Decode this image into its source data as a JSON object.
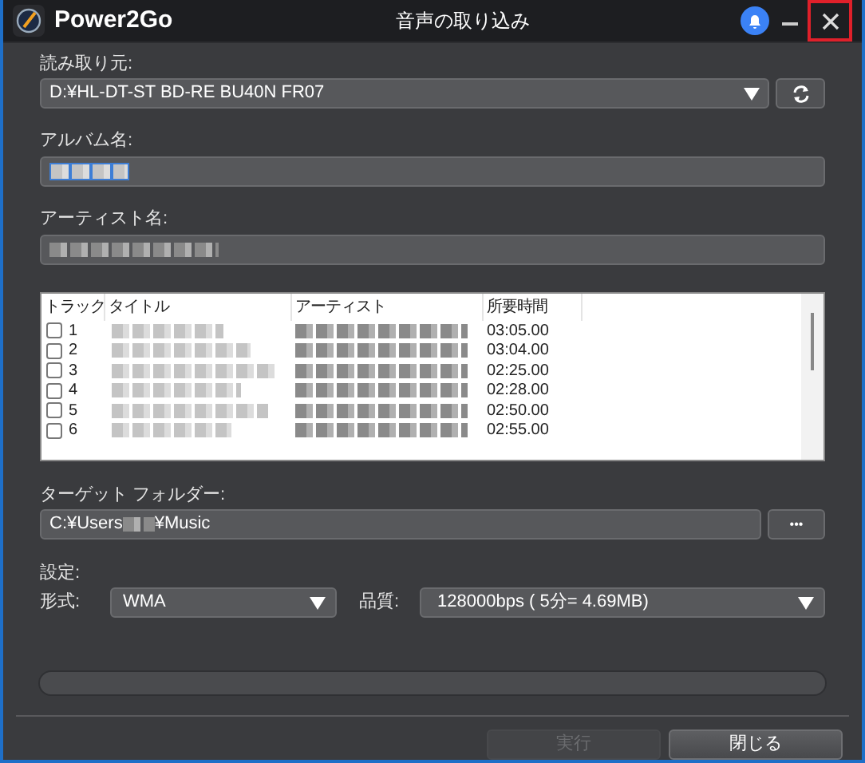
{
  "window": {
    "app_name": "Power2Go",
    "title": "音声の取り込み"
  },
  "source": {
    "label": "読み取り元:",
    "value": "D:¥HL-DT-ST BD-RE BU40N FR07"
  },
  "album": {
    "label": "アルバム名:",
    "redacted": true,
    "selected": true
  },
  "artist": {
    "label": "アーティスト名:",
    "redacted": true,
    "selected": false
  },
  "tracks": {
    "columns": [
      "トラック",
      "タイトル",
      "アーティスト",
      "所要時間"
    ],
    "rows": [
      {
        "track": "1",
        "checked": false,
        "redacted": true,
        "duration": "03:05.00"
      },
      {
        "track": "2",
        "checked": false,
        "redacted": true,
        "duration": "03:04.00"
      },
      {
        "track": "3",
        "checked": false,
        "redacted": true,
        "duration": "02:25.00"
      },
      {
        "track": "4",
        "checked": false,
        "redacted": true,
        "duration": "02:28.00"
      },
      {
        "track": "5",
        "checked": false,
        "redacted": true,
        "duration": "02:50.00"
      },
      {
        "track": "6",
        "checked": false,
        "redacted": true,
        "duration": "02:55.00"
      }
    ]
  },
  "target": {
    "label": "ターゲット フォルダー:",
    "path_start": "C:¥Users",
    "path_end": "¥Music",
    "browse": "•••"
  },
  "settings": {
    "label": "設定:",
    "format_label": "形式:",
    "format": "WMA",
    "quality_label": "品質:",
    "quality": "128000bps ( 5分= 4.69MB)"
  },
  "progress": {
    "level": 0
  },
  "buttons": [
    {
      "label": "実行",
      "disabled": true
    },
    {
      "label": "閉じる",
      "disabled": false
    }
  ]
}
